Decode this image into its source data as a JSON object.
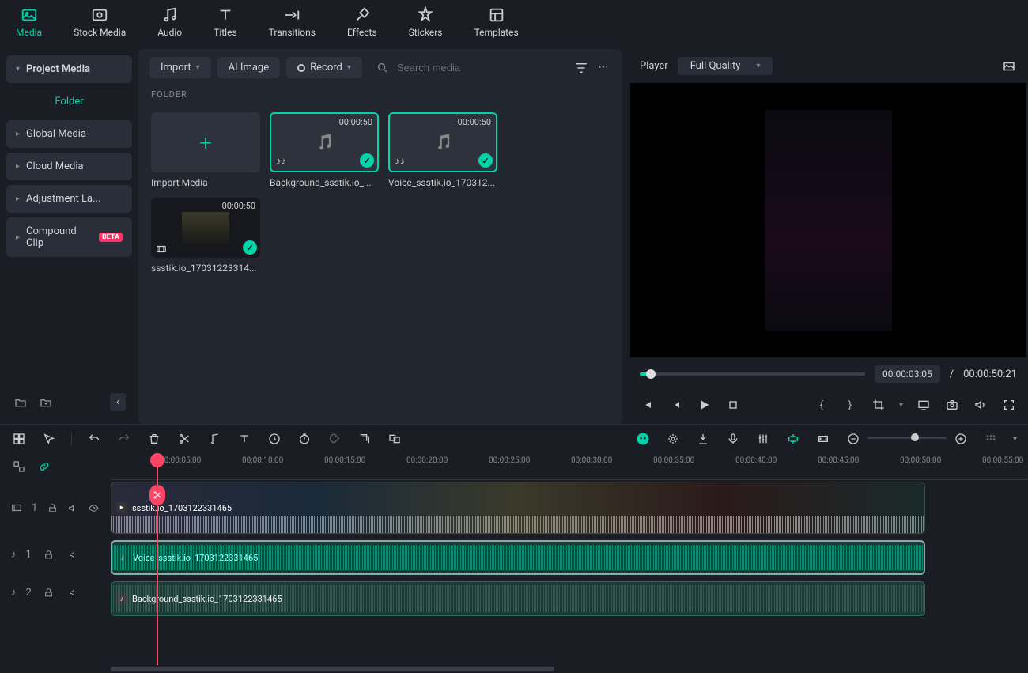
{
  "topTabs": [
    "Media",
    "Stock Media",
    "Audio",
    "Titles",
    "Transitions",
    "Effects",
    "Stickers",
    "Templates"
  ],
  "activeTab": 0,
  "sidebar": {
    "projectMedia": "Project Media",
    "folder": "Folder",
    "globalMedia": "Global Media",
    "cloudMedia": "Cloud Media",
    "adjustment": "Adjustment La...",
    "compound": "Compound Clip",
    "compoundBadge": "BETA"
  },
  "mediaToolbar": {
    "import": "Import",
    "aiImage": "AI Image",
    "record": "Record",
    "searchPlaceholder": "Search media"
  },
  "folderLabel": "FOLDER",
  "mediaItems": {
    "importMedia": "Import Media",
    "item1": {
      "dur": "00:00:50",
      "name": "Background_ssstik.io_..."
    },
    "item2": {
      "dur": "00:00:50",
      "name": "Voice_ssstik.io_170312..."
    },
    "item3": {
      "dur": "00:00:50",
      "name": "ssstik.io_17031223314..."
    }
  },
  "player": {
    "label": "Player",
    "quality": "Full Quality",
    "currentTime": "00:00:03:05",
    "separator": "/",
    "totalTime": "00:00:50:21"
  },
  "ruler": [
    "00:00:05:00",
    "00:00:10:00",
    "00:00:15:00",
    "00:00:20:00",
    "00:00:25:00",
    "00:00:30:00",
    "00:00:35:00",
    "00:00:40:00",
    "00:00:45:00",
    "00:00:50:00",
    "00:00:55:00"
  ],
  "tracks": {
    "video1": {
      "num": "1",
      "clip": "ssstik.io_1703122331465"
    },
    "audio1": {
      "num": "1",
      "clip": "Voice_ssstik.io_1703122331465"
    },
    "audio2": {
      "num": "2",
      "clip": "Background_ssstik.io_1703122331465"
    }
  },
  "colors": {
    "accent": "#00d4aa",
    "brand": "#ff3366"
  }
}
